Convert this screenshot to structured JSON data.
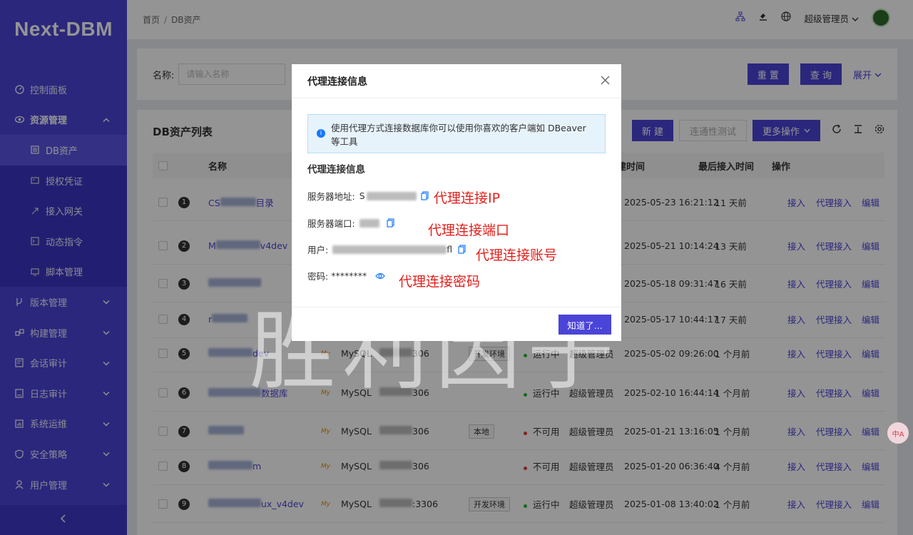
{
  "brand": "Next-DBM",
  "sidebar": {
    "items": [
      {
        "label": "控制面板",
        "icon": "dashboard-icon"
      },
      {
        "label": "资源管理",
        "icon": "resource-icon"
      },
      {
        "label": "版本管理",
        "icon": "branch-icon"
      },
      {
        "label": "构建管理",
        "icon": "build-icon"
      },
      {
        "label": "会话审计",
        "icon": "session-audit-icon"
      },
      {
        "label": "日志审计",
        "icon": "log-audit-icon"
      },
      {
        "label": "系统运维",
        "icon": "ops-icon"
      },
      {
        "label": "安全策略",
        "icon": "shield-icon"
      },
      {
        "label": "用户管理",
        "icon": "user-icon"
      }
    ],
    "sub": [
      {
        "label": "DB资产",
        "icon": "db-asset-icon"
      },
      {
        "label": "授权凭证",
        "icon": "credential-icon"
      },
      {
        "label": "接入网关",
        "icon": "gateway-icon"
      },
      {
        "label": "动态指令",
        "icon": "command-icon"
      },
      {
        "label": "脚本管理",
        "icon": "script-icon"
      }
    ]
  },
  "breadcrumb": {
    "home": "首页",
    "current": "DB资产"
  },
  "user": {
    "name": "超级管理员"
  },
  "filter": {
    "label": "名称:",
    "placeholder": "请输入名称",
    "reset": "重 置",
    "query": "查 询",
    "expand": "展开"
  },
  "panel": {
    "title": "DB资产列表",
    "new": "新 建",
    "test": "连通性测试",
    "more": "更多操作"
  },
  "columns": {
    "name": "名称",
    "created": "创建时间",
    "last": "最后接入时间",
    "ops": "操作"
  },
  "rows": [
    {
      "n": "1",
      "name": "CS",
      "name2": "目录",
      "created": "2025-05-23 16:21:12",
      "last": "11 天前"
    },
    {
      "n": "2",
      "name": "M",
      "name2": "v4dev",
      "created": "2025-05-21 10:14:24",
      "last": "13 天前"
    },
    {
      "n": "3",
      "name": "",
      "name2": "",
      "created": "2025-05-18 09:31:47",
      "last": "16 天前"
    },
    {
      "n": "4",
      "name": "r",
      "name2": "",
      "created": "2025-05-17 10:44:17",
      "last": "17 天前"
    },
    {
      "n": "5",
      "name": "",
      "name2": "dev",
      "type": "MySQL",
      "port": "306",
      "tag": "开发环境",
      "status": "运行中",
      "statusColor": "#2db52d",
      "owner": "超级管理员",
      "created": "2025-05-02 09:26:00",
      "last": "1 个月前"
    },
    {
      "n": "6",
      "name": "",
      "name2": "数据库",
      "type": "MySQL",
      "port": "306",
      "tag": "",
      "status": "运行中",
      "statusColor": "#2db52d",
      "owner": "超级管理员",
      "created": "2025-02-10 16:44:14",
      "last": "1 个月前"
    },
    {
      "n": "7",
      "name": "",
      "name2": "",
      "type": "MySQL",
      "port": "306",
      "tag": "本地",
      "status": "不可用",
      "statusColor": "#e23b3b",
      "owner": "超级管理员",
      "created": "2025-01-21 13:16:05",
      "last": "1 个月前"
    },
    {
      "n": "8",
      "name": "",
      "name2": "m",
      "type": "MySQL",
      "port": "306",
      "tag": "",
      "status": "不可用",
      "statusColor": "#e23b3b",
      "owner": "超级管理员",
      "created": "2025-01-20 06:36:40",
      "last": "4 个月前"
    },
    {
      "n": "9",
      "name": "",
      "name2": "ux_v4dev",
      "type": "MySQL",
      "port": ":3306",
      "tag": "开发环境",
      "status": "运行中",
      "statusColor": "#2db52d",
      "owner": "超级管理员",
      "created": "2025-01-08 13:40:02",
      "last": "1 个月前"
    }
  ],
  "row_ops": {
    "connect": "接入",
    "proxy": "代理接入",
    "edit": "编辑"
  },
  "modal": {
    "title": "代理连接信息",
    "alert": "使用代理方式连接数据库你可以使用你喜欢的客户端如 DBeaver 等工具",
    "section": "代理连接信息",
    "server_label": "服务器地址:",
    "server_prefix": "S",
    "port_label": "服务器端口:",
    "user_label": "用户:",
    "user_suffix": "fl",
    "pwd_label": "密码:",
    "pwd_value": "********",
    "ok": "知道了..."
  },
  "annotations": {
    "ip": "代理连接IP",
    "port": "代理连接端口",
    "user": "代理连接账号",
    "pwd": "代理连接密码"
  },
  "watermark": "胜利因子",
  "translate_badge": "中A"
}
